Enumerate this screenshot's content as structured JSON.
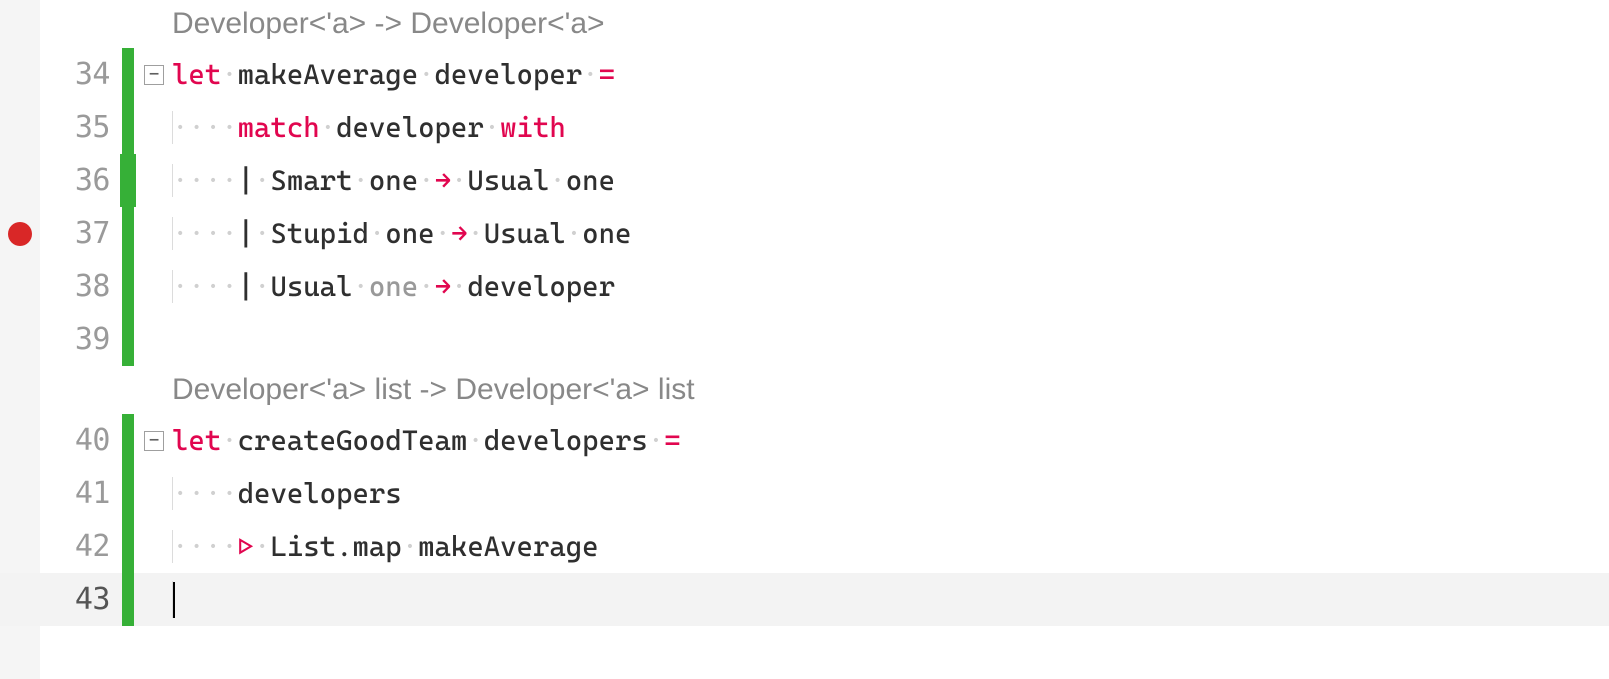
{
  "hints": {
    "makeAverage": "Developer<'a> -> Developer<'a>",
    "createGoodTeam": "Developer<'a> list -> Developer<'a> list"
  },
  "lines": {
    "34": {
      "number": "34",
      "breakpoint": false,
      "fold": true,
      "change": "normal",
      "tokens": {
        "let": "let",
        "name": "makeAverage",
        "param": "developer",
        "eq": "="
      }
    },
    "35": {
      "number": "35",
      "change": "normal",
      "tokens": {
        "match": "match",
        "subject": "developer",
        "with": "with"
      }
    },
    "36": {
      "number": "36",
      "change": "thick",
      "tokens": {
        "bar": "|",
        "ctor": "Smart",
        "var": "one",
        "arrow": "→",
        "resCtor": "Usual",
        "resVar": "one"
      }
    },
    "37": {
      "number": "37",
      "breakpoint": true,
      "change": "normal",
      "tokens": {
        "bar": "|",
        "ctor": "Stupid",
        "var": "one",
        "arrow": "→",
        "resCtor": "Usual",
        "resVar": "one"
      }
    },
    "38": {
      "number": "38",
      "change": "normal",
      "tokens": {
        "bar": "|",
        "ctor": "Usual",
        "varDim": "one",
        "arrow": "→",
        "res": "developer"
      }
    },
    "39": {
      "number": "39",
      "change": "normal"
    },
    "40": {
      "number": "40",
      "fold": true,
      "change": "normal",
      "tokens": {
        "let": "let",
        "name": "createGoodTeam",
        "param": "developers",
        "eq": "="
      }
    },
    "41": {
      "number": "41",
      "change": "normal",
      "tokens": {
        "id": "developers"
      }
    },
    "42": {
      "number": "42",
      "change": "normal",
      "tokens": {
        "pipe": "▷",
        "mod": "List.map",
        "fn": "makeAverage"
      }
    },
    "43": {
      "number": "43",
      "change": "normal",
      "current": true
    }
  },
  "whitespace": {
    "dot": "·",
    "indent4": "····"
  }
}
